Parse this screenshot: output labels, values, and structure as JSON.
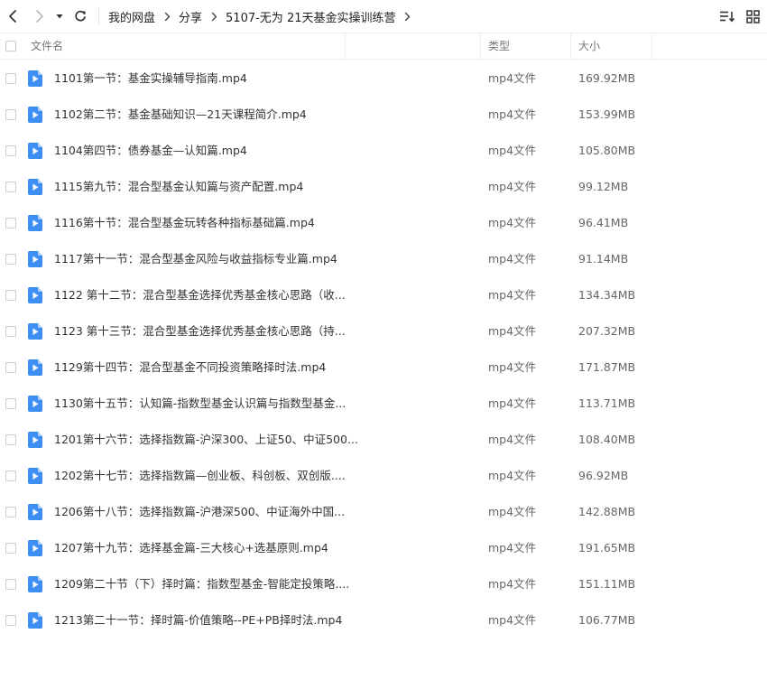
{
  "breadcrumb": {
    "items": [
      "我的网盘",
      "分享",
      "5107-无为 21天基金实操训练营"
    ]
  },
  "header": {
    "name": "文件名",
    "type": "类型",
    "size": "大小"
  },
  "files": [
    {
      "name": "1101第一节：基金实操辅导指南.mp4",
      "type": "mp4文件",
      "size": "169.92MB"
    },
    {
      "name": "1102第二节：基金基础知识—21天课程简介.mp4",
      "type": "mp4文件",
      "size": "153.99MB"
    },
    {
      "name": "1104第四节：债券基金—认知篇.mp4",
      "type": "mp4文件",
      "size": "105.80MB"
    },
    {
      "name": "1115第九节：混合型基金认知篇与资产配置.mp4",
      "type": "mp4文件",
      "size": "99.12MB"
    },
    {
      "name": "1116第十节：混合型基金玩转各种指标基础篇.mp4",
      "type": "mp4文件",
      "size": "96.41MB"
    },
    {
      "name": "1117第十一节：混合型基金风险与收益指标专业篇.mp4",
      "type": "mp4文件",
      "size": "91.14MB"
    },
    {
      "name": "1122 第十二节：混合型基金选择优秀基金核心思路（收...",
      "type": "mp4文件",
      "size": "134.34MB"
    },
    {
      "name": "1123 第十三节：混合型基金选择优秀基金核心思路（持...",
      "type": "mp4文件",
      "size": "207.32MB"
    },
    {
      "name": "1129第十四节：混合型基金不同投资策略择时法.mp4",
      "type": "mp4文件",
      "size": "171.87MB"
    },
    {
      "name": "1130第十五节：认知篇-指数型基金认识篇与指数型基金...",
      "type": "mp4文件",
      "size": "113.71MB"
    },
    {
      "name": "1201第十六节：选择指数篇-沪深300、上证50、中证500...",
      "type": "mp4文件",
      "size": "108.40MB"
    },
    {
      "name": "1202第十七节：选择指数篇—创业板、科创板、双创版....",
      "type": "mp4文件",
      "size": "96.92MB"
    },
    {
      "name": "1206第十八节：选择指数篇-沪港深500、中证海外中国...",
      "type": "mp4文件",
      "size": "142.88MB"
    },
    {
      "name": "1207第十九节：选择基金篇-三大核心+选基原则.mp4",
      "type": "mp4文件",
      "size": "191.65MB"
    },
    {
      "name": "1209第二十节（下）择时篇：指数型基金-智能定投策略....",
      "type": "mp4文件",
      "size": "151.11MB"
    },
    {
      "name": "1213第二十一节：择时篇-价值策略--PE+PB择时法.mp4",
      "type": "mp4文件",
      "size": "106.77MB"
    }
  ],
  "colors": {
    "file_icon": "#3d8ef5",
    "border": "#eeeeee"
  }
}
